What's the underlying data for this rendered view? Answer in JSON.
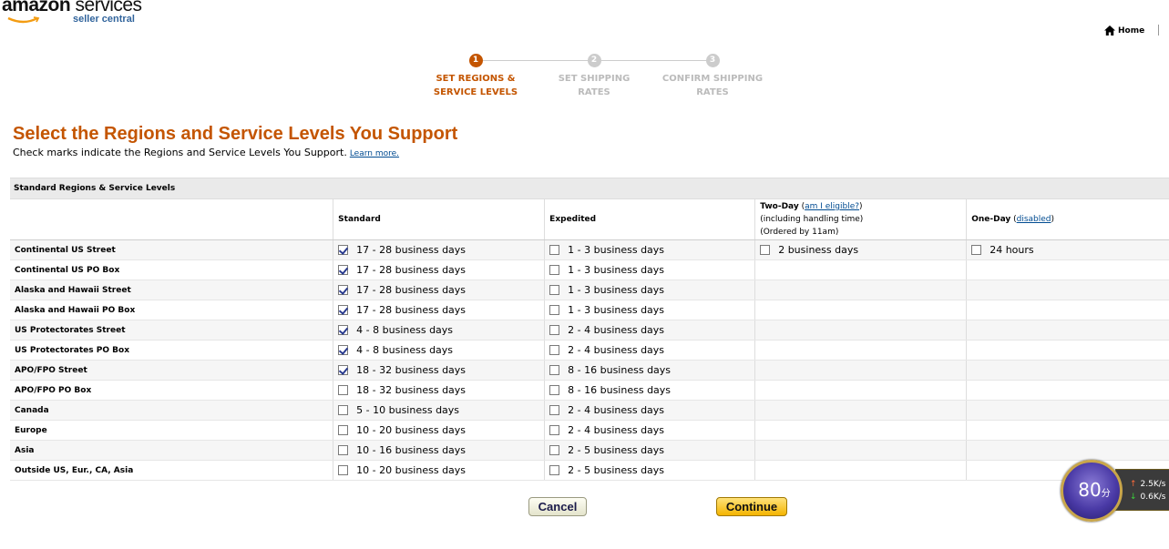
{
  "header": {
    "brand_bold": "amazon",
    "brand_light": " services",
    "brand_sub": "seller central",
    "home_label": "Home"
  },
  "steps": [
    {
      "number": "1",
      "line1": "SET REGIONS &",
      "line2": "SERVICE LEVELS",
      "active": true
    },
    {
      "number": "2",
      "line1": "SET SHIPPING",
      "line2": "RATES",
      "active": false
    },
    {
      "number": "3",
      "line1": "CONFIRM SHIPPING",
      "line2": "RATES",
      "active": false
    }
  ],
  "page": {
    "title": "Select the Regions and Service Levels You Support",
    "subtitle": "Check marks indicate the Regions and Service Levels You Support.",
    "learn_more": "Learn more."
  },
  "table": {
    "section_title": "Standard Regions & Service Levels",
    "headers": {
      "standard": "Standard",
      "expedited": "Expedited",
      "two_day": "Two-Day",
      "two_day_link": "am I eligible?",
      "two_day_note1": "(including handling time)",
      "two_day_note2": "(Ordered by 11am)",
      "one_day": "One-Day",
      "one_day_link": "disabled"
    },
    "rows": [
      {
        "region": "Continental US Street",
        "standard": "17 - 28 business days",
        "standard_checked": true,
        "expedited": "1 - 3 business days",
        "expedited_checked": false,
        "two_day": "2 business days",
        "two_day_checked": false,
        "one_day": "24 hours",
        "one_day_checked": false
      },
      {
        "region": "Continental US PO Box",
        "standard": "17 - 28 business days",
        "standard_checked": true,
        "expedited": "1 - 3 business days",
        "expedited_checked": false
      },
      {
        "region": "Alaska and Hawaii Street",
        "standard": "17 - 28 business days",
        "standard_checked": true,
        "expedited": "1 - 3 business days",
        "expedited_checked": false
      },
      {
        "region": "Alaska and Hawaii PO Box",
        "standard": "17 - 28 business days",
        "standard_checked": true,
        "expedited": "1 - 3 business days",
        "expedited_checked": false
      },
      {
        "region": "US Protectorates Street",
        "standard": "4 - 8 business days",
        "standard_checked": true,
        "expedited": "2 - 4 business days",
        "expedited_checked": false
      },
      {
        "region": "US Protectorates PO Box",
        "standard": "4 - 8 business days",
        "standard_checked": true,
        "expedited": "2 - 4 business days",
        "expedited_checked": false
      },
      {
        "region": "APO/FPO Street",
        "standard": "18 - 32 business days",
        "standard_checked": true,
        "expedited": "8 - 16 business days",
        "expedited_checked": false
      },
      {
        "region": "APO/FPO PO Box",
        "standard": "18 - 32 business days",
        "standard_checked": false,
        "expedited": "8 - 16 business days",
        "expedited_checked": false
      },
      {
        "region": "Canada",
        "standard": "5 - 10 business days",
        "standard_checked": false,
        "expedited": "2 - 4 business days",
        "expedited_checked": false
      },
      {
        "region": "Europe",
        "standard": "10 - 20 business days",
        "standard_checked": false,
        "expedited": "2 - 4 business days",
        "expedited_checked": false
      },
      {
        "region": "Asia",
        "standard": "10 - 16 business days",
        "standard_checked": false,
        "expedited": "2 - 5 business days",
        "expedited_checked": false
      },
      {
        "region": "Outside US, Eur., CA, Asia",
        "standard": "10 - 20 business days",
        "standard_checked": false,
        "expedited": "2 - 5 business days",
        "expedited_checked": false
      }
    ]
  },
  "buttons": {
    "cancel": "Cancel",
    "continue": "Continue"
  },
  "widget": {
    "score": "80",
    "unit": "分",
    "upload": "2.5K/s",
    "download": "0.6K/s"
  },
  "colors": {
    "accent_orange": "#c45500",
    "link_blue": "#004b91",
    "continue_yellow": "#f4b400"
  }
}
